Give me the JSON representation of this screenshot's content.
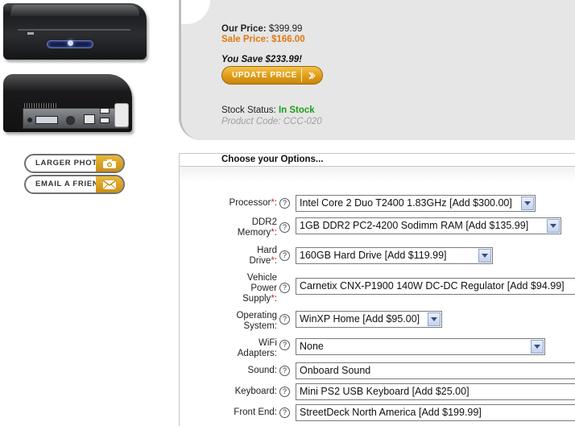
{
  "product_images": {
    "front_alt": "",
    "back_alt": ""
  },
  "buttons": {
    "larger_photo": "LARGER PHOTO",
    "email_friend": "EMAIL A FRIEND",
    "update_price": "UPDATE PRICE"
  },
  "pricing": {
    "our_price_label": "Our Price:",
    "our_price_value": "$399.99",
    "sale_price_label": "Sale Price:",
    "sale_price_value": "$166.00",
    "you_save": "You Save $233.99!",
    "stock_label": "Stock Status:",
    "stock_value": "In Stock",
    "product_code": "Product Code: CCC-020"
  },
  "options": {
    "header": "Choose your Options...",
    "help_glyph": "?",
    "required_mark": "*",
    "rows": [
      {
        "label": "Processor",
        "required": true,
        "value": "Intel Core 2 Duo T2400 1.83GHz [Add $300.00]"
      },
      {
        "label_line1": "DDR2",
        "label_line2": "Memory",
        "required": true,
        "value": "1GB DDR2 PC2-4200 Sodimm RAM [Add $135.99]"
      },
      {
        "label_line1": "Hard",
        "label_line2": "Drive",
        "required": true,
        "value": "160GB Hard Drive [Add $119.99]"
      },
      {
        "label_line1": "Vehicle",
        "label_line2": "Power",
        "label_line3": "Supply",
        "required": true,
        "value": "Carnetix CNX-P1900 140W DC-DC Regulator [Add $94.99]"
      },
      {
        "label_line1": "Operating",
        "label_line2": "System:",
        "required": false,
        "value": "WinXP Home [Add $95.00]"
      },
      {
        "label_line1": "WiFi",
        "label_line2": "Adapters:",
        "required": false,
        "value": "None"
      },
      {
        "label": "Sound:",
        "required": false,
        "value": "Onboard Sound"
      },
      {
        "label": "Keyboard:",
        "required": false,
        "value": "Mini PS2 USB Keyboard [Add $25.00]"
      },
      {
        "label": "Front End:",
        "required": false,
        "value": "StreetDeck North America [Add $199.99]"
      }
    ]
  },
  "colors": {
    "sale": "#e07812",
    "in_stock": "#1c9e1c",
    "required": "#d22222",
    "accent_gold": "#e09c16"
  }
}
